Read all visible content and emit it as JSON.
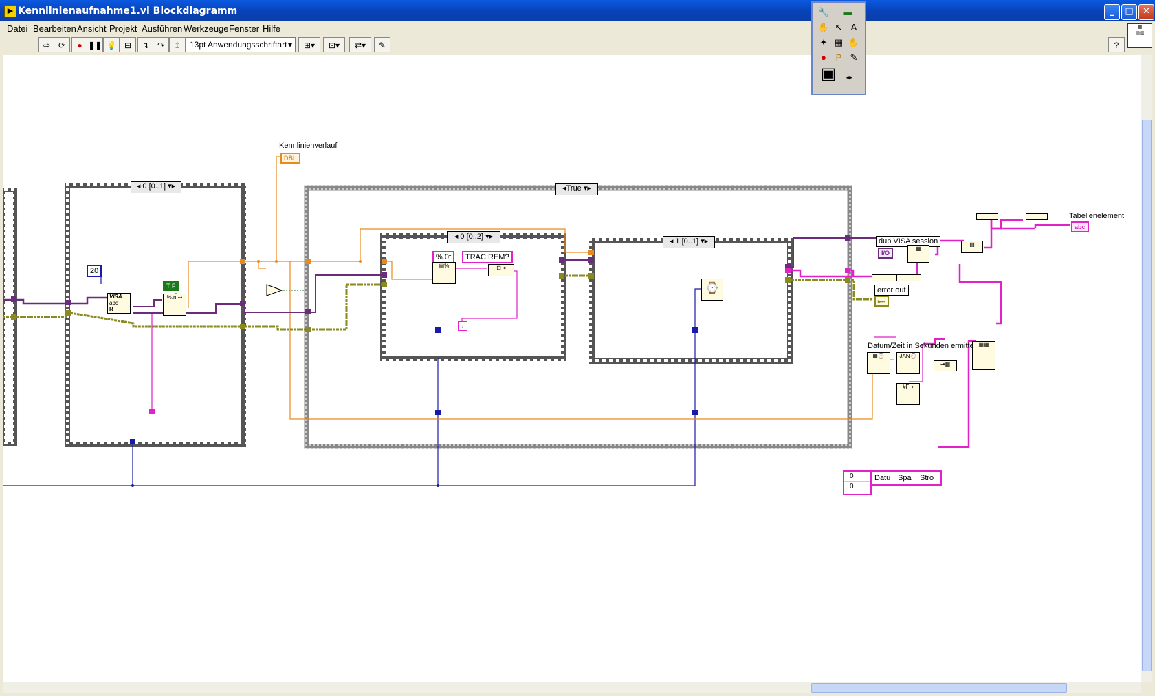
{
  "window": {
    "title": "Kennlinienaufnahme1.vi Blockdiagramm",
    "min": "_",
    "max": "□",
    "close": "✕"
  },
  "menu": [
    "Datei",
    "Bearbeiten",
    "Ansicht",
    "Projekt",
    "Ausführen",
    "Werkzeuge",
    "Fenster",
    "Hilfe"
  ],
  "toolbar": {
    "font": "13pt Anwendungsschriftart",
    "help": "?"
  },
  "diagram": {
    "indicator_kennlinie": "Kennlinienverlauf",
    "indicator_kennlinie_type": "DBL",
    "const_20": "20",
    "const_tf": "T F",
    "seq1_selector": "0 [0..1]",
    "case_selector": "True",
    "seq2_selector": "0 [0..2]",
    "seq3_selector": "1 [0..1]",
    "format_const": "%.0f",
    "cmd_const": "TRAC:REM?",
    "dup_visa": "dup VISA session",
    "dup_visa_type": "I/O",
    "error_out": "error out",
    "datum_label": "Datum/Zeit in Sekunden ermitteln",
    "tabellen_label": "Tabellenelement",
    "tabellen_type": "abc",
    "table_index_a": "0",
    "table_index_b": "0",
    "table_cells": [
      "Datu",
      "Spa",
      "Stro"
    ],
    "visa_read_label": "VISA",
    "visa_read_sub": "abc",
    "visa_read_r": "R",
    "true_term": "?"
  },
  "palette": {
    "tools": [
      "🔧",
      "▬",
      "✋",
      "↖",
      "A",
      "✦",
      "▦",
      "✋",
      "●",
      "P",
      "✎",
      "▣",
      "✒"
    ]
  }
}
